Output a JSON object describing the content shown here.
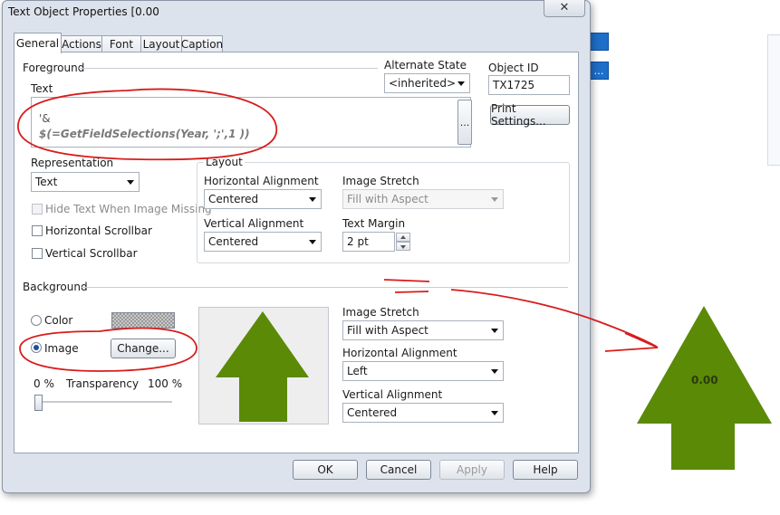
{
  "window": {
    "title": "Text Object Properties [0.00",
    "close_glyph": "✕"
  },
  "tabs": [
    {
      "label": "General",
      "active": true
    },
    {
      "label": "Actions",
      "active": false
    },
    {
      "label": "Font",
      "active": false
    },
    {
      "label": "Layout",
      "active": false
    },
    {
      "label": "Caption",
      "active": false
    }
  ],
  "foreground": {
    "section_label": "Foreground",
    "text_label": "Text",
    "text_line1": "'&",
    "text_line2": "$(=GetFieldSelections(Year, ';',1 ))",
    "ellipsis": "...",
    "alternate_state_label": "Alternate State",
    "alternate_state_value": "<inherited>",
    "object_id_label": "Object ID",
    "object_id_value": "TX1725",
    "print_settings": "Print Settings...",
    "representation_label": "Representation",
    "representation_value": "Text",
    "hide_text_label": "Hide Text When Image Missing",
    "hscroll_label": "Horizontal Scrollbar",
    "vscroll_label": "Vertical Scrollbar"
  },
  "layout_group": {
    "title": "Layout",
    "h_align_label": "Horizontal Alignment",
    "h_align_value": "Centered",
    "v_align_label": "Vertical Alignment",
    "v_align_value": "Centered",
    "image_stretch_label": "Image Stretch",
    "image_stretch_value": "Fill with Aspect",
    "text_margin_label": "Text Margin",
    "text_margin_value": "2 pt"
  },
  "background": {
    "section_label": "Background",
    "color_label": "Color",
    "image_label": "Image",
    "image_selected": true,
    "change_button": "Change...",
    "transparency_label": "Transparency",
    "transparency_min": "0 %",
    "transparency_max": "100 %",
    "transparency_value": 0,
    "image_stretch_label": "Image Stretch",
    "image_stretch_value": "Fill with Aspect",
    "h_align_label": "Horizontal Alignment",
    "h_align_value": "Left",
    "v_align_label": "Vertical Alignment",
    "v_align_value": "Centered"
  },
  "buttons": {
    "ok": "OK",
    "cancel": "Cancel",
    "apply": "Apply",
    "help": "Help"
  },
  "outside_object": {
    "value": "0.00",
    "arrow_color": "#5b8a07"
  },
  "colors": {
    "annotation_red": "#d81c1c",
    "arrow_green": "#5b8a07",
    "dialog_bg": "#dde3ec"
  }
}
